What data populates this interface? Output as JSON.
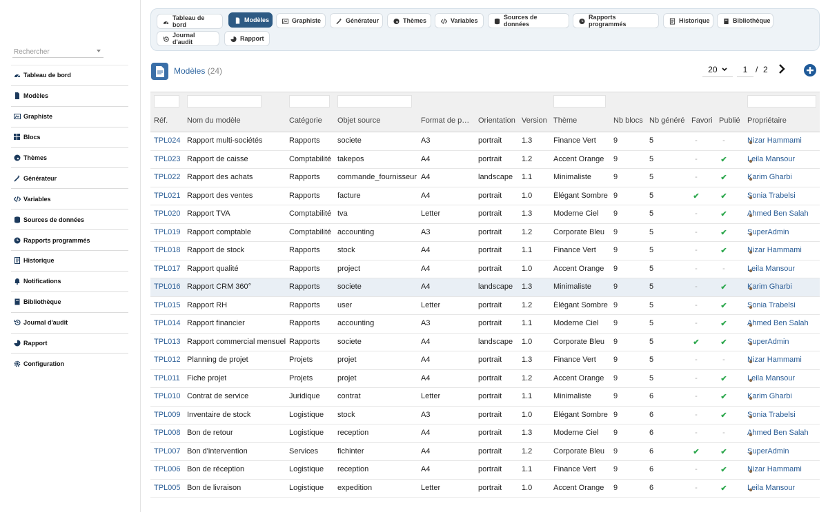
{
  "sidebar": {
    "search_placeholder": "Rechercher",
    "items": [
      {
        "label": "Tableau de bord",
        "icon": "dashboard-icon"
      },
      {
        "label": "Modèles",
        "icon": "file-icon"
      },
      {
        "label": "Graphiste",
        "icon": "image-icon"
      },
      {
        "label": "Blocs",
        "icon": "grid-icon"
      },
      {
        "label": "Thèmes",
        "icon": "palette-icon"
      },
      {
        "label": "Générateur",
        "icon": "wand-icon"
      },
      {
        "label": "Variables",
        "icon": "code-icon"
      },
      {
        "label": "Sources de données",
        "icon": "database-icon"
      },
      {
        "label": "Rapports programmés",
        "icon": "clock-icon"
      },
      {
        "label": "Historique",
        "icon": "document-icon"
      },
      {
        "label": "Notifications",
        "icon": "bell-icon"
      },
      {
        "label": "Bibliothèque",
        "icon": "book-icon"
      },
      {
        "label": "Journal d'audit",
        "icon": "history-icon"
      },
      {
        "label": "Rapport",
        "icon": "pie-chart-icon"
      },
      {
        "label": "Configuration",
        "icon": "gear-icon"
      }
    ]
  },
  "tabs": [
    {
      "label": "Tableau de bord",
      "icon": "dashboard-icon",
      "active": false
    },
    {
      "label": "Modèles",
      "icon": "file-icon",
      "active": true
    },
    {
      "label": "Graphiste",
      "icon": "image-icon",
      "active": false
    },
    {
      "label": "Générateur",
      "icon": "wand-icon",
      "active": false
    },
    {
      "label": "Thèmes",
      "icon": "palette-icon",
      "active": false
    },
    {
      "label": "Variables",
      "icon": "code-icon",
      "active": false
    },
    {
      "label": "Sources de données",
      "icon": "database-icon",
      "active": false
    },
    {
      "label": "Rapports programmés",
      "icon": "clock-icon",
      "active": false
    },
    {
      "label": "Historique",
      "icon": "document-icon",
      "active": false
    },
    {
      "label": "Bibliothèque",
      "icon": "book-icon",
      "active": false
    },
    {
      "label": "Journal d'audit",
      "icon": "history-icon",
      "active": false
    },
    {
      "label": "Rapport",
      "icon": "pie-chart-icon",
      "active": false
    }
  ],
  "page": {
    "title": "Modèles",
    "count": "(24)",
    "page_size": "20",
    "current_page": "1",
    "separator": "/",
    "total_pages": "2"
  },
  "table": {
    "headers": [
      "Réf.",
      "Nom du modèle",
      "Catégorie",
      "Objet source",
      "Format de p…",
      "Orientation",
      "Version",
      "Thème",
      "Nb blocs",
      "Nb généré",
      "Favori",
      "Publié",
      "Propriétaire"
    ],
    "rows": [
      {
        "ref": "TPL024",
        "nom": "Rapport multi-sociétés",
        "cat": "Rapports",
        "obj": "societe",
        "fmt": "A3",
        "ori": "portrait",
        "ver": "1.3",
        "theme": "Finance Vert",
        "nbb": "9",
        "nbg": "5",
        "fav": "-",
        "pub": "-",
        "owner": "Nizar Hammami"
      },
      {
        "ref": "TPL023",
        "nom": "Rapport de caisse",
        "cat": "Comptabilité",
        "obj": "takepos",
        "fmt": "A4",
        "ori": "portrait",
        "ver": "1.2",
        "theme": "Accent Orange",
        "nbb": "9",
        "nbg": "5",
        "fav": "-",
        "pub": "✔",
        "owner": "Leila Mansour"
      },
      {
        "ref": "TPL022",
        "nom": "Rapport des achats",
        "cat": "Rapports",
        "obj": "commande_fournisseur",
        "fmt": "A4",
        "ori": "landscape",
        "ver": "1.1",
        "theme": "Minimaliste",
        "nbb": "9",
        "nbg": "5",
        "fav": "-",
        "pub": "✔",
        "owner": "Karim Gharbi"
      },
      {
        "ref": "TPL021",
        "nom": "Rapport des ventes",
        "cat": "Rapports",
        "obj": "facture",
        "fmt": "A4",
        "ori": "portrait",
        "ver": "1.0",
        "theme": "Élégant Sombre",
        "nbb": "9",
        "nbg": "5",
        "fav": "✔",
        "pub": "✔",
        "owner": "Sonia Trabelsi"
      },
      {
        "ref": "TPL020",
        "nom": "Rapport TVA",
        "cat": "Comptabilité",
        "obj": "tva",
        "fmt": "Letter",
        "ori": "portrait",
        "ver": "1.3",
        "theme": "Moderne Ciel",
        "nbb": "9",
        "nbg": "5",
        "fav": "-",
        "pub": "✔",
        "owner": "Ahmed Ben Salah"
      },
      {
        "ref": "TPL019",
        "nom": "Rapport comptable",
        "cat": "Comptabilité",
        "obj": "accounting",
        "fmt": "A3",
        "ori": "portrait",
        "ver": "1.2",
        "theme": "Corporate Bleu",
        "nbb": "9",
        "nbg": "5",
        "fav": "-",
        "pub": "✔",
        "owner": "SuperAdmin"
      },
      {
        "ref": "TPL018",
        "nom": "Rapport de stock",
        "cat": "Rapports",
        "obj": "stock",
        "fmt": "A4",
        "ori": "portrait",
        "ver": "1.1",
        "theme": "Finance Vert",
        "nbb": "9",
        "nbg": "5",
        "fav": "-",
        "pub": "✔",
        "owner": "Nizar Hammami"
      },
      {
        "ref": "TPL017",
        "nom": "Rapport qualité",
        "cat": "Rapports",
        "obj": "project",
        "fmt": "A4",
        "ori": "portrait",
        "ver": "1.0",
        "theme": "Accent Orange",
        "nbb": "9",
        "nbg": "5",
        "fav": "-",
        "pub": "-",
        "owner": "Leila Mansour"
      },
      {
        "ref": "TPL016",
        "nom": "Rapport CRM 360°",
        "cat": "Rapports",
        "obj": "societe",
        "fmt": "A4",
        "ori": "landscape",
        "ver": "1.3",
        "theme": "Minimaliste",
        "nbb": "9",
        "nbg": "5",
        "fav": "-",
        "pub": "✔",
        "owner": "Karim Gharbi"
      },
      {
        "ref": "TPL015",
        "nom": "Rapport RH",
        "cat": "Rapports",
        "obj": "user",
        "fmt": "Letter",
        "ori": "portrait",
        "ver": "1.2",
        "theme": "Élégant Sombre",
        "nbb": "9",
        "nbg": "5",
        "fav": "-",
        "pub": "✔",
        "owner": "Sonia Trabelsi"
      },
      {
        "ref": "TPL014",
        "nom": "Rapport financier",
        "cat": "Rapports",
        "obj": "accounting",
        "fmt": "A3",
        "ori": "portrait",
        "ver": "1.1",
        "theme": "Moderne Ciel",
        "nbb": "9",
        "nbg": "5",
        "fav": "-",
        "pub": "✔",
        "owner": "Ahmed Ben Salah"
      },
      {
        "ref": "TPL013",
        "nom": "Rapport commercial mensuel",
        "cat": "Rapports",
        "obj": "societe",
        "fmt": "A4",
        "ori": "landscape",
        "ver": "1.0",
        "theme": "Corporate Bleu",
        "nbb": "9",
        "nbg": "5",
        "fav": "✔",
        "pub": "✔",
        "owner": "SuperAdmin"
      },
      {
        "ref": "TPL012",
        "nom": "Planning de projet",
        "cat": "Projets",
        "obj": "projet",
        "fmt": "A4",
        "ori": "portrait",
        "ver": "1.3",
        "theme": "Finance Vert",
        "nbb": "9",
        "nbg": "5",
        "fav": "-",
        "pub": "-",
        "owner": "Nizar Hammami"
      },
      {
        "ref": "TPL011",
        "nom": "Fiche projet",
        "cat": "Projets",
        "obj": "projet",
        "fmt": "A4",
        "ori": "portrait",
        "ver": "1.2",
        "theme": "Accent Orange",
        "nbb": "9",
        "nbg": "5",
        "fav": "-",
        "pub": "✔",
        "owner": "Leila Mansour"
      },
      {
        "ref": "TPL010",
        "nom": "Contrat de service",
        "cat": "Juridique",
        "obj": "contrat",
        "fmt": "Letter",
        "ori": "portrait",
        "ver": "1.1",
        "theme": "Minimaliste",
        "nbb": "9",
        "nbg": "6",
        "fav": "-",
        "pub": "✔",
        "owner": "Karim Gharbi"
      },
      {
        "ref": "TPL009",
        "nom": "Inventaire de stock",
        "cat": "Logistique",
        "obj": "stock",
        "fmt": "A3",
        "ori": "portrait",
        "ver": "1.0",
        "theme": "Élégant Sombre",
        "nbb": "9",
        "nbg": "6",
        "fav": "-",
        "pub": "✔",
        "owner": "Sonia Trabelsi"
      },
      {
        "ref": "TPL008",
        "nom": "Bon de retour",
        "cat": "Logistique",
        "obj": "reception",
        "fmt": "A4",
        "ori": "portrait",
        "ver": "1.3",
        "theme": "Moderne Ciel",
        "nbb": "9",
        "nbg": "6",
        "fav": "-",
        "pub": "-",
        "owner": "Ahmed Ben Salah"
      },
      {
        "ref": "TPL007",
        "nom": "Bon d'intervention",
        "cat": "Services",
        "obj": "fichinter",
        "fmt": "A4",
        "ori": "portrait",
        "ver": "1.2",
        "theme": "Corporate Bleu",
        "nbb": "9",
        "nbg": "6",
        "fav": "✔",
        "pub": "✔",
        "owner": "SuperAdmin"
      },
      {
        "ref": "TPL006",
        "nom": "Bon de réception",
        "cat": "Logistique",
        "obj": "reception",
        "fmt": "A4",
        "ori": "portrait",
        "ver": "1.1",
        "theme": "Finance Vert",
        "nbb": "9",
        "nbg": "6",
        "fav": "-",
        "pub": "✔",
        "owner": "Nizar Hammami"
      },
      {
        "ref": "TPL005",
        "nom": "Bon de livraison",
        "cat": "Logistique",
        "obj": "expedition",
        "fmt": "Letter",
        "ori": "portrait",
        "ver": "1.0",
        "theme": "Accent Orange",
        "nbb": "9",
        "nbg": "6",
        "fav": "-",
        "pub": "✔",
        "owner": "Leila Mansour"
      }
    ]
  },
  "colors": {
    "accent": "#2d5a84",
    "link": "#2a5d96",
    "check": "#2fa84f",
    "owner_icon": "#8a6a4a"
  }
}
